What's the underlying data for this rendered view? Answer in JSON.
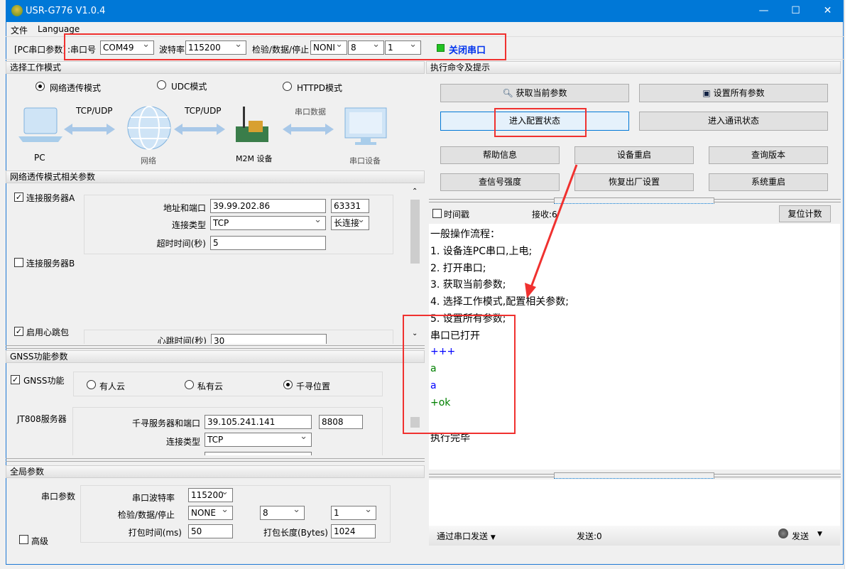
{
  "window": {
    "title": "USR-G776 V1.0.4",
    "minimize": "—",
    "maximize": "☐",
    "close": "✕"
  },
  "menu": [
    "文件",
    "Language"
  ],
  "toolbar": {
    "group_label": "[PC串口参数]",
    "port_label": ":串口号",
    "port": "COM49",
    "baud_label": "波特率",
    "baud": "115200",
    "parity_label": "检验/数据/停止",
    "parity": "NONI",
    "data_bits": "8",
    "stop_bits": "1",
    "close_port": "关闭串口",
    "led_color": "#22c222"
  },
  "mode": {
    "header": "选择工作模式",
    "options": [
      "网络透传模式",
      "UDC模式",
      "HTTPD模式"
    ],
    "selected": 0,
    "diagram": {
      "pc": "PC",
      "link1": "TCP/UDP",
      "net": "网络",
      "link2": "TCP/UDP",
      "m2m": "M2M 设备",
      "link3": "串口数据",
      "serial_dev": "串口设备"
    }
  },
  "net": {
    "header": "网络透传模式相关参数",
    "serverA": {
      "label": "连接服务器A",
      "checked": true,
      "addr_label": "地址和端口",
      "addr": "39.99.202.86",
      "port": "63331",
      "type_label": "连接类型",
      "type": "TCP",
      "conn": "长连接",
      "timeout_label": "超时时间(秒)",
      "timeout": "5"
    },
    "serverB": {
      "label": "连接服务器B",
      "checked": false
    },
    "heartbeat": {
      "label": "启用心跳包",
      "checked": true,
      "time_label": "心跳时间(秒)",
      "time": "30"
    }
  },
  "gnss": {
    "header": "GNSS功能参数",
    "enable_label": "GNSS功能",
    "options": [
      "有人云",
      "私有云",
      "千寻位置"
    ],
    "selected": 2,
    "jt808_label": "JT808服务器",
    "server_label": "千寻服务器和端口",
    "server": "39.105.241.141",
    "port": "8808",
    "type_label": "连接类型",
    "type": "TCP"
  },
  "global": {
    "header": "全局参数",
    "serial_label": "串口参数",
    "baud_label": "串口波特率",
    "baud": "115200",
    "parity_label": "检验/数据/停止",
    "parity": "NONE",
    "data_bits": "8",
    "stop_bits": "1",
    "pack_time_label": "打包时间(ms)",
    "pack_time": "50",
    "pack_len_label": "打包长度(Bytes)",
    "pack_len": "1024",
    "advanced_label": "高级"
  },
  "commands": {
    "header": "执行命令及提示",
    "get_params": "获取当前参数",
    "set_params": "设置所有参数",
    "enter_config": "进入配置状态",
    "enter_comm": "进入通讯状态",
    "help": "帮助信息",
    "reboot_device": "设备重启",
    "query_version": "查询版本",
    "signal": "查信号强度",
    "factory_reset": "恢复出厂设置",
    "system_reboot": "系统重启"
  },
  "receive": {
    "timestamp_label": "时间戳",
    "count_label": "接收:6",
    "reset_count": "复位计数"
  },
  "log": [
    {
      "text": "一般操作流程：",
      "color": "#000000"
    },
    {
      "text": "1. 设备连PC串口,上电;",
      "color": "#000000"
    },
    {
      "text": "2. 打开串口;",
      "color": "#000000"
    },
    {
      "text": "3. 获取当前参数;",
      "color": "#000000"
    },
    {
      "text": "4. 选择工作模式,配置相关参数;",
      "color": "#000000"
    },
    {
      "text": "5. 设置所有参数;",
      "color": "#000000"
    },
    {
      "text": "串口已打开",
      "color": "#000000"
    },
    {
      "text": "+++",
      "color": "#0000ff"
    },
    {
      "text": "a",
      "color": "#008000"
    },
    {
      "text": "a",
      "color": "#0000ff"
    },
    {
      "text": "+ok",
      "color": "#008000"
    },
    {
      "text": "",
      "color": "#000000"
    },
    {
      "text": "执行完毕",
      "color": "#000000"
    }
  ],
  "send": {
    "mode": "通过串口发送",
    "count_label": "发送:0",
    "send_button": "发送"
  }
}
